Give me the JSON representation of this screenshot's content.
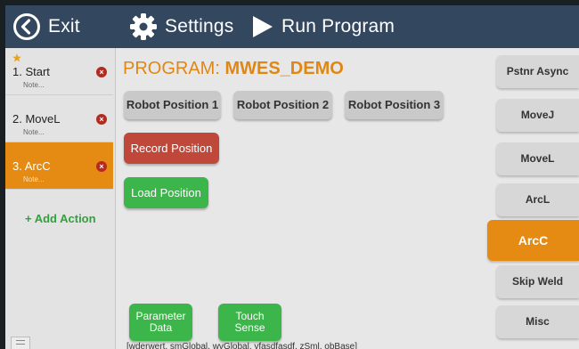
{
  "topbar": {
    "exit_label": "Exit",
    "settings_label": "Settings",
    "run_label": "Run Program",
    "icons": [
      "back-circle-icon",
      "gear-icon",
      "play-icon"
    ]
  },
  "sidebar": {
    "steps": [
      {
        "title": "1. Start",
        "note": "Note...",
        "starred": true
      },
      {
        "title": "2. MoveL",
        "note": "Note..."
      },
      {
        "title": "3. ArcC",
        "note": "Note...",
        "active": true
      }
    ],
    "add_action_label": "+ Add Action"
  },
  "program": {
    "prefix": "PROGRAM: ",
    "name": "MWES_DEMO"
  },
  "positions": [
    "Robot Position 1",
    "Robot Position 2",
    "Robot Position 3"
  ],
  "actions": {
    "record_label": "Record Position",
    "load_label": "Load Position",
    "parameter_label": "Parameter Data",
    "touch_label": "Touch Sense"
  },
  "variables_text": "[wderwert, smGlobal, wvGlobal, vfasdfasdf, zSml, obBase]",
  "right_buttons": [
    {
      "label": "Pstnr Async"
    },
    {
      "label": "MoveJ"
    },
    {
      "label": "MoveL"
    },
    {
      "label": "ArcL"
    },
    {
      "label": "ArcC",
      "active": true
    },
    {
      "label": "Skip Weld"
    },
    {
      "label": "Misc"
    }
  ],
  "colors": {
    "topbar": "#33475f",
    "accent": "#e58a12",
    "record": "#c0483b",
    "green": "#3cb54a",
    "delete": "#b52a20"
  }
}
